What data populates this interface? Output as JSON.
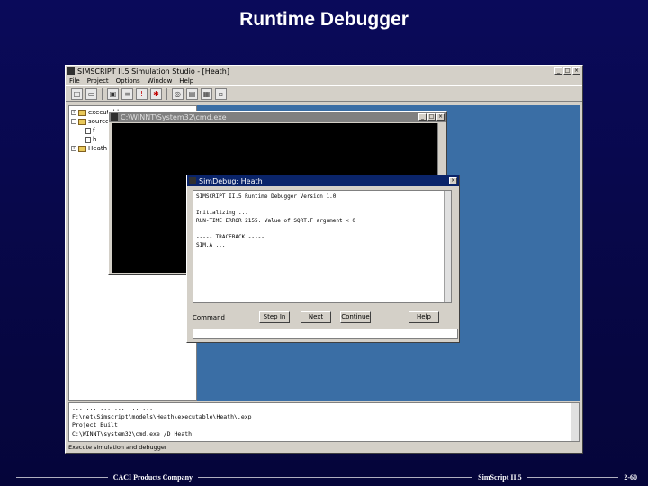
{
  "slide": {
    "title": "Runtime Debugger",
    "footer_left": "CACI Products Company",
    "footer_center": "SimScript II.5",
    "footer_right": "2-60"
  },
  "studio": {
    "title": "SIMSCRIPT II.5 Simulation Studio - [Heath]",
    "menu": [
      "File",
      "Project",
      "Options",
      "Window",
      "Help"
    ],
    "toolbar_icons": [
      "new-icon",
      "open-icon",
      "save-icon",
      "build-icon",
      "run-icon",
      "debug-icon",
      "settings-icon",
      "graphics-icon",
      "window-icon",
      "close-icon"
    ],
    "tree": [
      {
        "label": "executable",
        "type": "folder"
      },
      {
        "label": "sources",
        "type": "folder"
      },
      {
        "label": "f",
        "type": "file"
      },
      {
        "label": "h",
        "type": "file"
      },
      {
        "label": "Heath",
        "type": "folder"
      }
    ],
    "output_lines": [
      "... ... ... ... ... ...",
      "F:\\net\\Simscript\\models\\Heath\\executable\\Heath\\.exp",
      "Project Built",
      "C:\\WINNT\\system32\\cmd.exe /D Heath"
    ],
    "status": "Execute simulation and debugger"
  },
  "console": {
    "title": "C:\\WINNT\\System32\\cmd.exe"
  },
  "debugger": {
    "title": "SimDebug: Heath",
    "lines": [
      "SIMSCRIPT II.5 Runtime Debugger Version 1.0",
      "",
      "Initializing ...",
      "RUN-TIME ERROR 2155. Value of SQRT.F argument < 0",
      "",
      "----- TRACEBACK -----",
      "SIM.A ..."
    ],
    "command_label": "Command",
    "buttons": {
      "step_in": "Step In",
      "next": "Next",
      "continue": "Continue",
      "help": "Help"
    }
  }
}
